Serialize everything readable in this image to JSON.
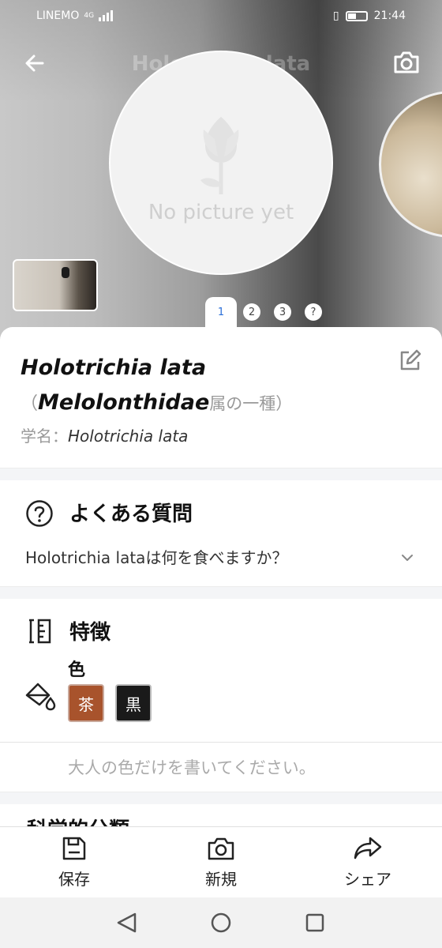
{
  "status": {
    "carrier": "LINEMO",
    "network": "4G",
    "time": "21:44"
  },
  "hero": {
    "title": "Holotrichia lata",
    "placeholder_text": "No picture yet",
    "pages": [
      "1",
      "2",
      "3",
      "?"
    ],
    "active_page": "1"
  },
  "species": {
    "name": "Holotrichia lata",
    "paren_open": "（",
    "family": "Melolonthidae",
    "family_suffix": "属の一種）",
    "sci_label": "学名：",
    "sci_value": "Holotrichia lata"
  },
  "faq": {
    "title": "よくある質問",
    "question": "Holotrichia lataは何を食べますか？"
  },
  "features": {
    "title": "特徴",
    "color_label": "色",
    "colors": [
      {
        "label": "茶",
        "hex": "#a8532c"
      },
      {
        "label": "黒",
        "hex": "#1a1a1a"
      }
    ],
    "hint": "大人の色だけを書いてください。"
  },
  "next_section": {
    "title": "科学的分類"
  },
  "bottom_bar": {
    "save": "保存",
    "new": "新規",
    "share": "シェア"
  }
}
